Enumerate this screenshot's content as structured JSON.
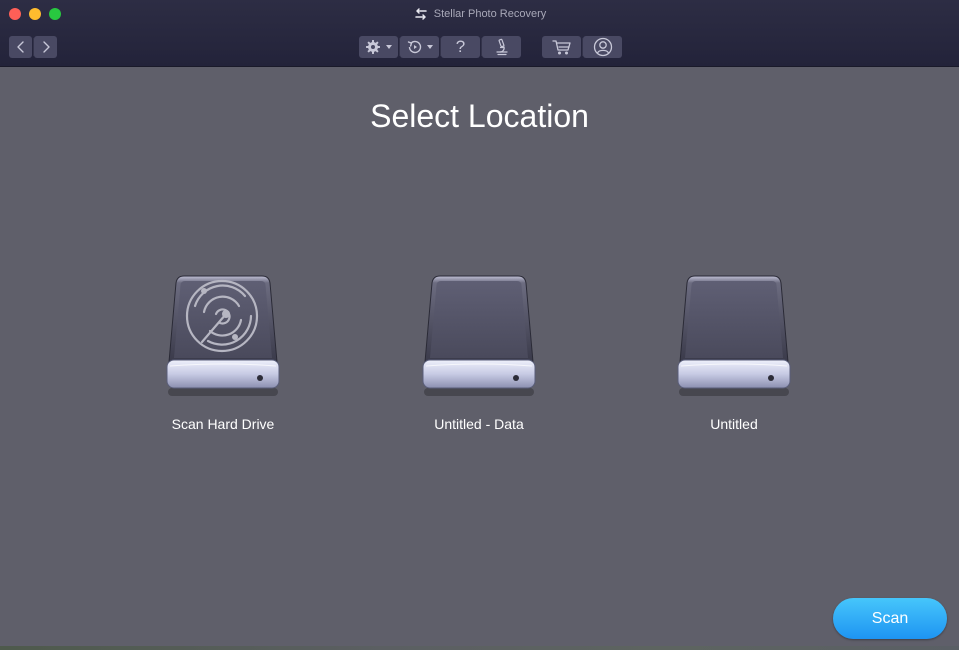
{
  "window": {
    "title": "Stellar Photo Recovery",
    "colors": {
      "titlebar": "#2a2a40",
      "content": "#5f5f6a",
      "accent": "#2aa6f6"
    }
  },
  "toolbar": {
    "icons": [
      "back-icon",
      "forward-icon",
      "gear-icon",
      "history-icon",
      "help-icon",
      "microscope-icon",
      "cart-icon",
      "user-icon"
    ],
    "help_label": "?"
  },
  "main": {
    "heading": "Select Location",
    "drives": [
      {
        "label": "Scan Hard Drive",
        "icon": "radar-icon"
      },
      {
        "label": "Untitled - Data",
        "icon": "hard-drive-icon"
      },
      {
        "label": "Untitled",
        "icon": "hard-drive-icon"
      }
    ]
  },
  "actions": {
    "scan_label": "Scan"
  }
}
